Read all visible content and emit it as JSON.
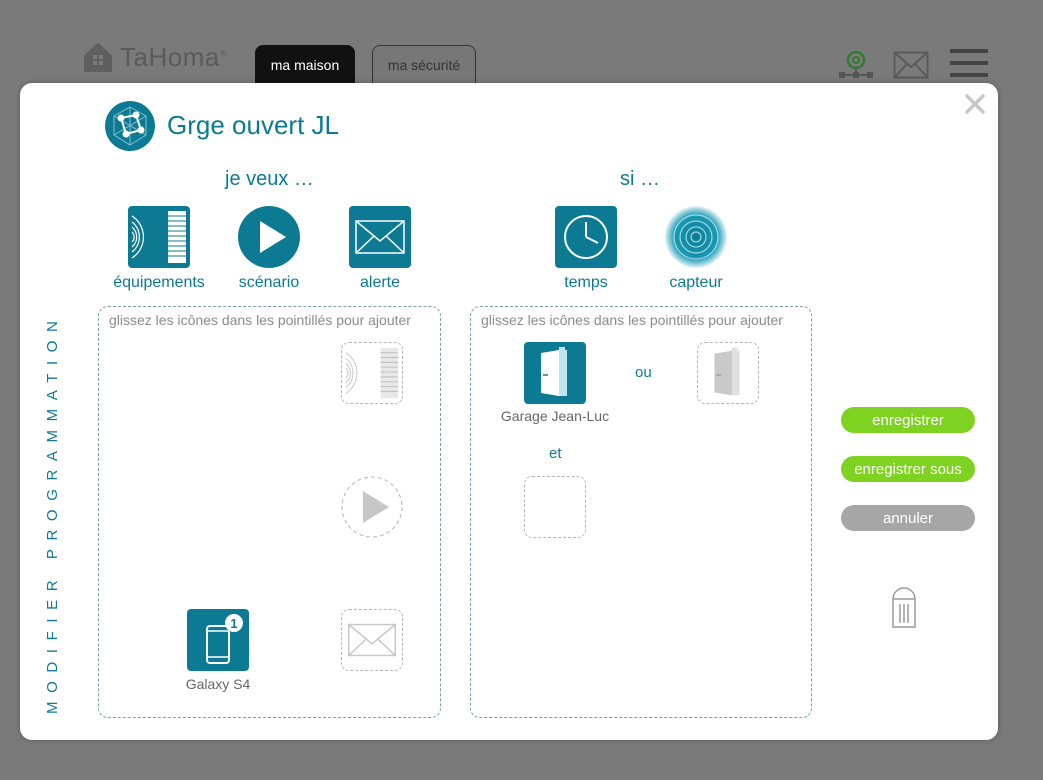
{
  "app": {
    "brand": "TaHoma",
    "brand_mark": "®",
    "tabs": [
      {
        "label": "ma maison",
        "active": true
      },
      {
        "label": "ma sécurité",
        "active": false
      }
    ],
    "header_icons": [
      "at-network-icon",
      "mail-icon",
      "hamburger-menu-icon"
    ]
  },
  "modal": {
    "title": "Grge ouvert JL",
    "side_label": "MODIFIER PROGRAMMATION",
    "want_section": {
      "heading": "je veux …",
      "palette": [
        {
          "label": "équipements",
          "icon": "equipment-icon"
        },
        {
          "label": "scénario",
          "icon": "play-icon"
        },
        {
          "label": "alerte",
          "icon": "mail-icon"
        }
      ],
      "drop_hint": "glissez les icônes dans les pointillés pour ajouter",
      "items": [
        {
          "label": "Galaxy S4",
          "icon": "smartphone-icon",
          "badge": "1"
        }
      ]
    },
    "if_section": {
      "heading": "si …",
      "palette": [
        {
          "label": "temps",
          "icon": "clock-icon"
        },
        {
          "label": "capteur",
          "icon": "sensor-icon"
        }
      ],
      "drop_hint": "glissez les icônes dans les pointillés pour ajouter",
      "items": [
        {
          "label": "Garage Jean-Luc",
          "icon": "door-icon"
        }
      ],
      "or_label": "ou",
      "and_label": "et"
    },
    "buttons": {
      "save": "enregistrer",
      "save_as": "enregistrer sous",
      "cancel": "annuler"
    }
  },
  "colors": {
    "accent": "#0d7a93",
    "green": "#7ed321",
    "grey_button": "#a6a6a6",
    "overlay": "#7a7a7a"
  }
}
